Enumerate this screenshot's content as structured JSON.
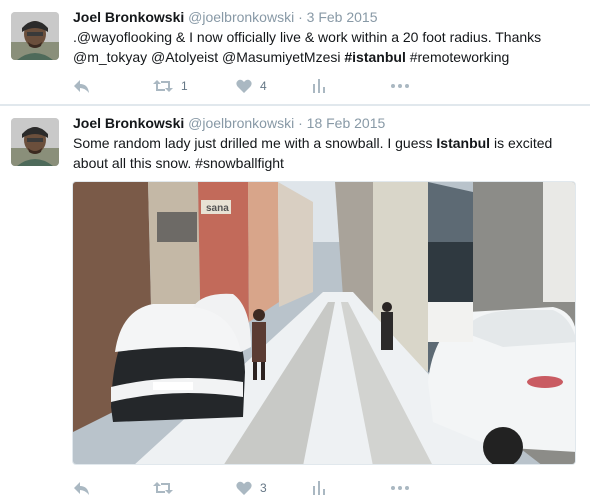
{
  "tweets": [
    {
      "name": "Joel Bronkowski",
      "handle": "@joelbronkowski",
      "separator": "·",
      "date": "3 Feb 2015",
      "text_parts": [
        ".@wayoflooking & I now officially live & work within a 20 foot radius. Thanks @m_tokyay @Atolyeist @MasumiyetMzesi ",
        "#istanbul",
        " #remoteworking"
      ],
      "retweet_count": "1",
      "like_count": "4"
    },
    {
      "name": "Joel Bronkowski",
      "handle": "@joelbronkowski",
      "separator": "·",
      "date": "18 Feb 2015",
      "text_parts": [
        "Some random lady just drilled me with a snowball. I guess ",
        "Istanbul",
        " is excited about all this snow. #snowballfight"
      ],
      "retweet_count": "",
      "like_count": "3",
      "photo_sign_text": "sana"
    }
  ],
  "icons": {
    "reply": "reply-icon",
    "retweet": "retweet-icon",
    "like": "heart-icon",
    "analytics": "analytics-icon",
    "more": "more-icon"
  },
  "colors": {
    "name": "#14171a",
    "meta": "#8899a6",
    "icon": "#aab8c2",
    "divider": "#e1e8ed"
  }
}
